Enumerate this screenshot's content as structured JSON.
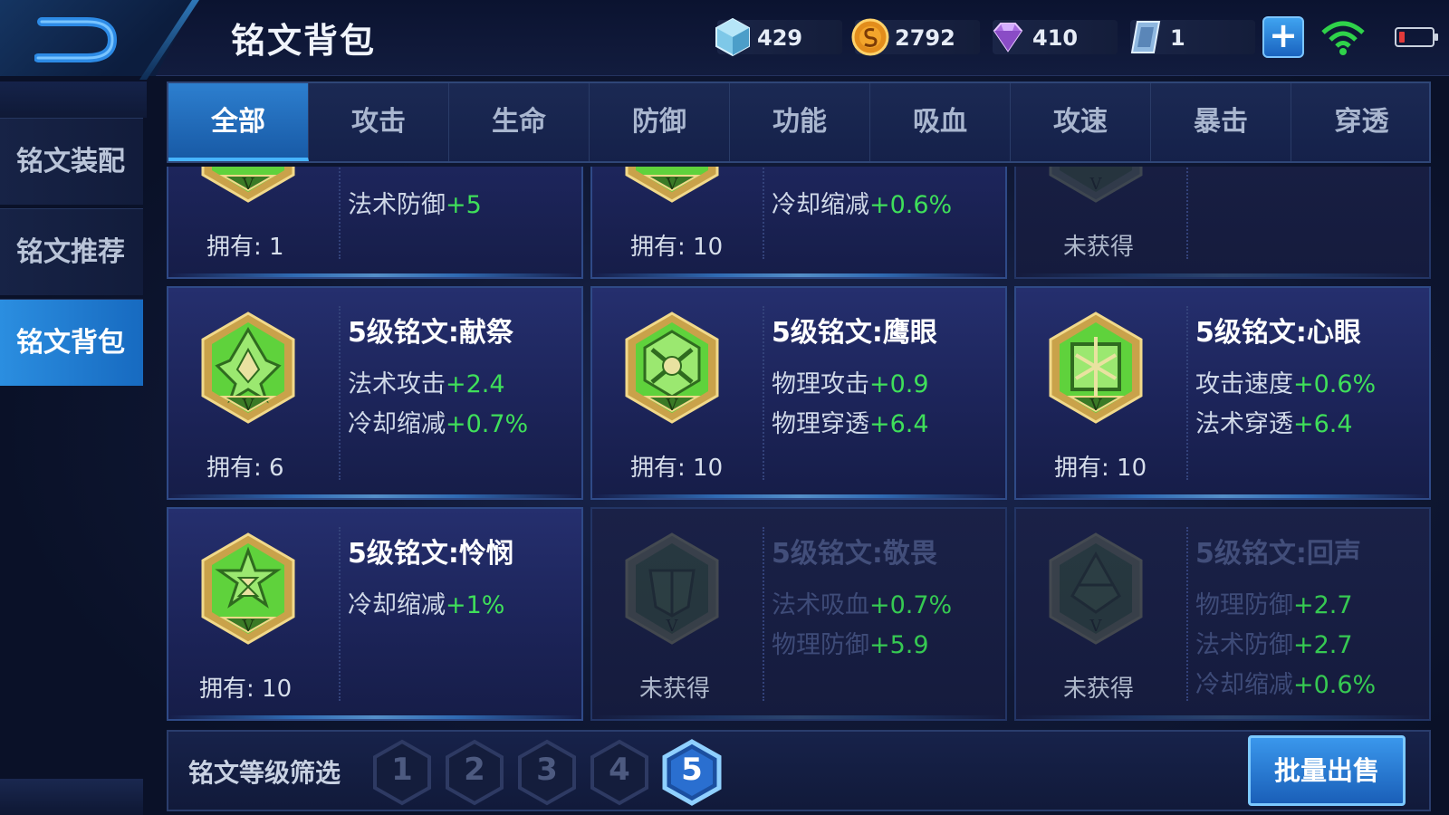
{
  "header": {
    "title": "铭文背包",
    "currencies": [
      {
        "name": "crystal-icon",
        "value": "429"
      },
      {
        "name": "gold-coin-icon",
        "value": "2792"
      },
      {
        "name": "purple-diamond-icon",
        "value": "410"
      },
      {
        "name": "ticket-icon",
        "value": "1"
      }
    ],
    "plus_label": "+"
  },
  "sidebar": {
    "items": [
      {
        "label": "铭文装配",
        "active": false
      },
      {
        "label": "铭文推荐",
        "active": false
      },
      {
        "label": "铭文背包",
        "active": true
      }
    ]
  },
  "tabs": [
    "全部",
    "攻击",
    "生命",
    "防御",
    "功能",
    "吸血",
    "攻速",
    "暴击",
    "穿透"
  ],
  "active_tab": "全部",
  "cards": [
    {
      "name": "",
      "stats": [
        {
          "label": "法术防御",
          "value": "+5"
        }
      ],
      "owned": "拥有: 1",
      "acquired": true
    },
    {
      "name": "",
      "stats": [
        {
          "label": "冷却缩减",
          "value": "+0.6%"
        }
      ],
      "owned": "拥有: 10",
      "acquired": true
    },
    {
      "name": "",
      "stats": [],
      "owned": "未获得",
      "acquired": false
    },
    {
      "name": "5级铭文:献祭",
      "stats": [
        {
          "label": "法术攻击",
          "value": "+2.4"
        },
        {
          "label": "冷却缩减",
          "value": "+0.7%"
        }
      ],
      "owned": "拥有: 6",
      "acquired": true
    },
    {
      "name": "5级铭文:鹰眼",
      "stats": [
        {
          "label": "物理攻击",
          "value": "+0.9"
        },
        {
          "label": "物理穿透",
          "value": "+6.4"
        }
      ],
      "owned": "拥有: 10",
      "acquired": true
    },
    {
      "name": "5级铭文:心眼",
      "stats": [
        {
          "label": "攻击速度",
          "value": "+0.6%"
        },
        {
          "label": "法术穿透",
          "value": "+6.4"
        }
      ],
      "owned": "拥有: 10",
      "acquired": true
    },
    {
      "name": "5级铭文:怜悯",
      "stats": [
        {
          "label": "冷却缩减",
          "value": "+1%"
        }
      ],
      "owned": "拥有: 10",
      "acquired": true
    },
    {
      "name": "5级铭文:敬畏",
      "stats": [
        {
          "label": "法术吸血",
          "value": "+0.7%"
        },
        {
          "label": "物理防御",
          "value": "+5.9"
        }
      ],
      "owned": "未获得",
      "acquired": false
    },
    {
      "name": "5级铭文:回声",
      "stats": [
        {
          "label": "物理防御",
          "value": "+2.7"
        },
        {
          "label": "法术防御",
          "value": "+2.7"
        },
        {
          "label": "冷却缩减",
          "value": "+0.6%"
        }
      ],
      "owned": "未获得",
      "acquired": false
    }
  ],
  "footer": {
    "filter_label": "铭文等级筛选",
    "levels": [
      "1",
      "2",
      "3",
      "4",
      "5"
    ],
    "active_level": "5",
    "sell_label": "批量出售"
  },
  "colors": {
    "accent": "#2b8ee0",
    "stat_value": "#3fdf5a",
    "rune_green": "#5fd23c",
    "rune_gold": "#c9a24a"
  }
}
